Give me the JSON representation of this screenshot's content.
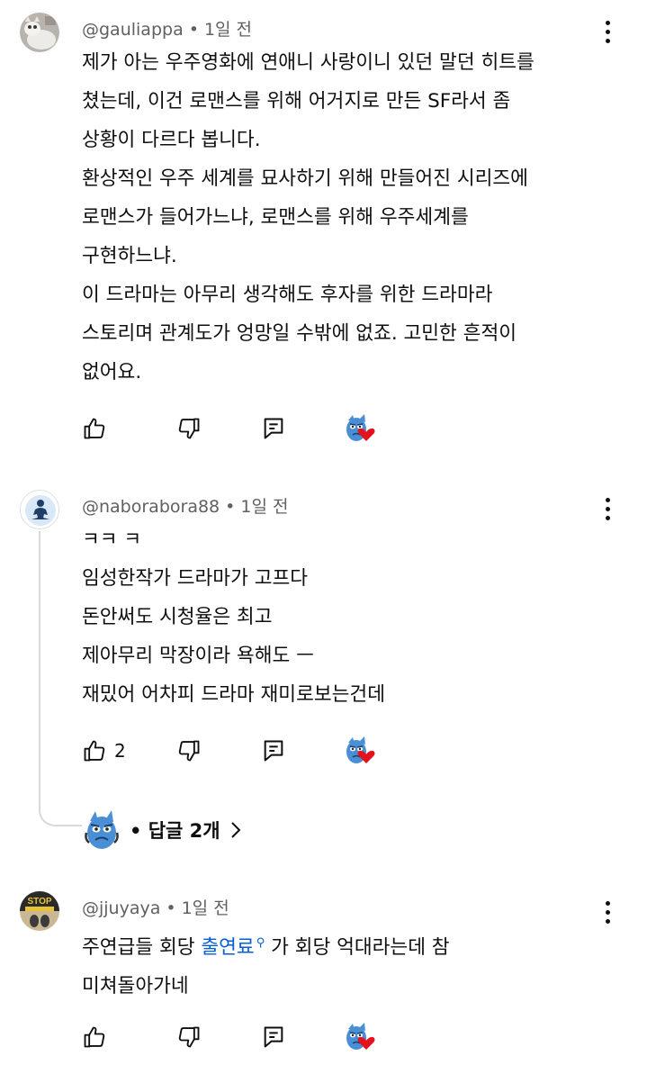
{
  "comments": [
    {
      "handle": "@gauliappa",
      "time": "1일 전",
      "lines": [
        "제가 아는 우주영화에 연애니 사랑이니 있던 말던 히트를",
        "쳤는데, 이건 로맨스를 위해 어거지로 만든 SF라서 좀",
        "상황이 다르다 봅니다.",
        "환상적인 우주 세계를 묘사하기 위해 만들어진 시리즈에",
        "로맨스가 들어가느냐, 로맨스를 위해 우주세계를",
        "구현하느냐.",
        "이 드라마는 아무리 생각해도 후자를 위한 드라마라",
        "스토리며 관계도가 엉망일 수밖에 없죠. 고민한 흔적이",
        "없어요."
      ],
      "likes": ""
    },
    {
      "handle": "@naborabora88",
      "time": "1일 전",
      "lines": [
        "ㅋㅋ ㅋ",
        "임성한작가 드라마가 고프다",
        "돈안써도 시청율은 최고",
        "제아무리 막장이라 욕해도 ㅡ",
        "재밌어 어차피 드라마 재미로보는건데"
      ],
      "likes": "2",
      "replies_label": "답글 2개"
    },
    {
      "handle": "@jjuyaya",
      "time": "1일 전",
      "line1_before": "주연급들 회당 ",
      "line1_link": "출연료",
      "line1_after": " 가 회당 억대라는데 참",
      "line2": "미쳐돌아가네",
      "likes": ""
    }
  ],
  "avatar3_text": "STOP",
  "colors": {
    "accent_link": "#065fd4",
    "meta": "#606060",
    "heart": "#e3131d"
  },
  "icons": [
    "like-icon",
    "dislike-icon",
    "reply-icon",
    "creator-heart-icon",
    "kebab-menu-icon",
    "chevron-right-icon",
    "search-icon"
  ]
}
